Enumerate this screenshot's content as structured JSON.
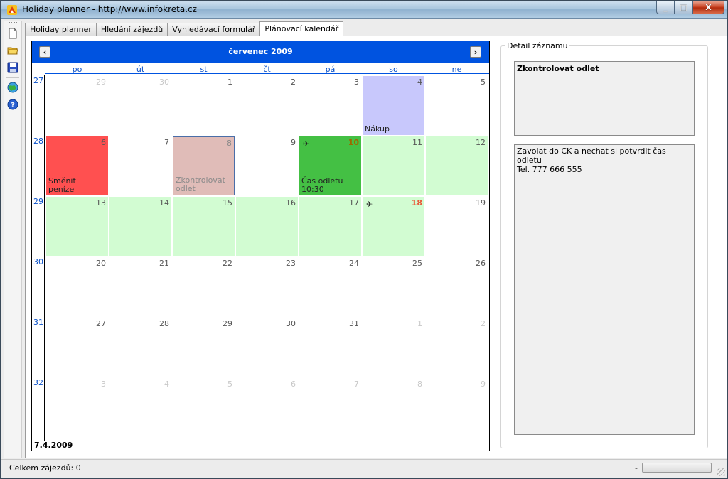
{
  "window": {
    "title": "Holiday planner - http://www.infokreta.cz",
    "minimize_label": "_",
    "maximize_label": "□",
    "close_label": "X"
  },
  "toolbar": {
    "icons": [
      "new-document-icon",
      "open-folder-icon",
      "save-icon",
      "globe-icon",
      "help-icon"
    ]
  },
  "tabs": [
    {
      "label": "Holiday planner",
      "active": false
    },
    {
      "label": "Hledání zájezdů",
      "active": false
    },
    {
      "label": "Vyhledávací formulář",
      "active": false
    },
    {
      "label": "Plánovací kalendář",
      "active": true
    }
  ],
  "calendar": {
    "month_label": "červenec 2009",
    "prev_label": "‹",
    "next_label": "›",
    "days_of_week": [
      "po",
      "út",
      "st",
      "čt",
      "pá",
      "so",
      "ne"
    ],
    "today_label": "7.4.2009",
    "weeks": [
      {
        "number": "27",
        "days": [
          {
            "day": "29",
            "other": true
          },
          {
            "day": "30",
            "other": true
          },
          {
            "day": "1"
          },
          {
            "day": "2"
          },
          {
            "day": "3"
          },
          {
            "day": "4",
            "color": "blue",
            "event": "Nákup"
          },
          {
            "day": "5"
          }
        ]
      },
      {
        "number": "28",
        "days": [
          {
            "day": "6",
            "color": "red",
            "event": "Směnit peníze"
          },
          {
            "day": "7"
          },
          {
            "day": "8",
            "color": "selected",
            "event": "Zkontrolovat odlet"
          },
          {
            "day": "9"
          },
          {
            "day": "10",
            "color": "dgreen",
            "highlight": true,
            "plane": true,
            "event": "Čas odletu 10:30"
          },
          {
            "day": "11",
            "color": "green"
          },
          {
            "day": "12",
            "color": "green"
          }
        ]
      },
      {
        "number": "29",
        "days": [
          {
            "day": "13",
            "color": "green"
          },
          {
            "day": "14",
            "color": "green"
          },
          {
            "day": "15",
            "color": "green"
          },
          {
            "day": "16",
            "color": "green"
          },
          {
            "day": "17",
            "color": "green"
          },
          {
            "day": "18",
            "color": "green",
            "red": true,
            "plane": true
          },
          {
            "day": "19"
          }
        ]
      },
      {
        "number": "30",
        "days": [
          {
            "day": "20"
          },
          {
            "day": "21"
          },
          {
            "day": "22"
          },
          {
            "day": "23"
          },
          {
            "day": "24"
          },
          {
            "day": "25"
          },
          {
            "day": "26"
          }
        ]
      },
      {
        "number": "31",
        "days": [
          {
            "day": "27"
          },
          {
            "day": "28"
          },
          {
            "day": "29"
          },
          {
            "day": "30"
          },
          {
            "day": "31"
          },
          {
            "day": "1",
            "other": true
          },
          {
            "day": "2",
            "other": true
          }
        ]
      },
      {
        "number": "32",
        "days": [
          {
            "day": "3",
            "other": true
          },
          {
            "day": "4",
            "other": true
          },
          {
            "day": "5",
            "other": true
          },
          {
            "day": "6",
            "other": true
          },
          {
            "day": "7",
            "other": true
          },
          {
            "day": "8",
            "other": true
          },
          {
            "day": "9",
            "other": true
          }
        ]
      }
    ],
    "colors": {
      "green": "#d2fcd2",
      "dgreen": "#44c044",
      "red": "#ff5050",
      "blue": "#c8c8fc",
      "selected": "#e0bcb8",
      "header": "#0053e0"
    }
  },
  "detail": {
    "legend": "Detail záznamu",
    "title": "Zkontrolovat odlet",
    "body_line1": "Zavolat do CK a nechat si potvrdit čas odletu",
    "body_line2": "Tel. 777 666 555"
  },
  "statusbar": {
    "text": "Celkem zájezdů: 0",
    "dash": "-"
  }
}
